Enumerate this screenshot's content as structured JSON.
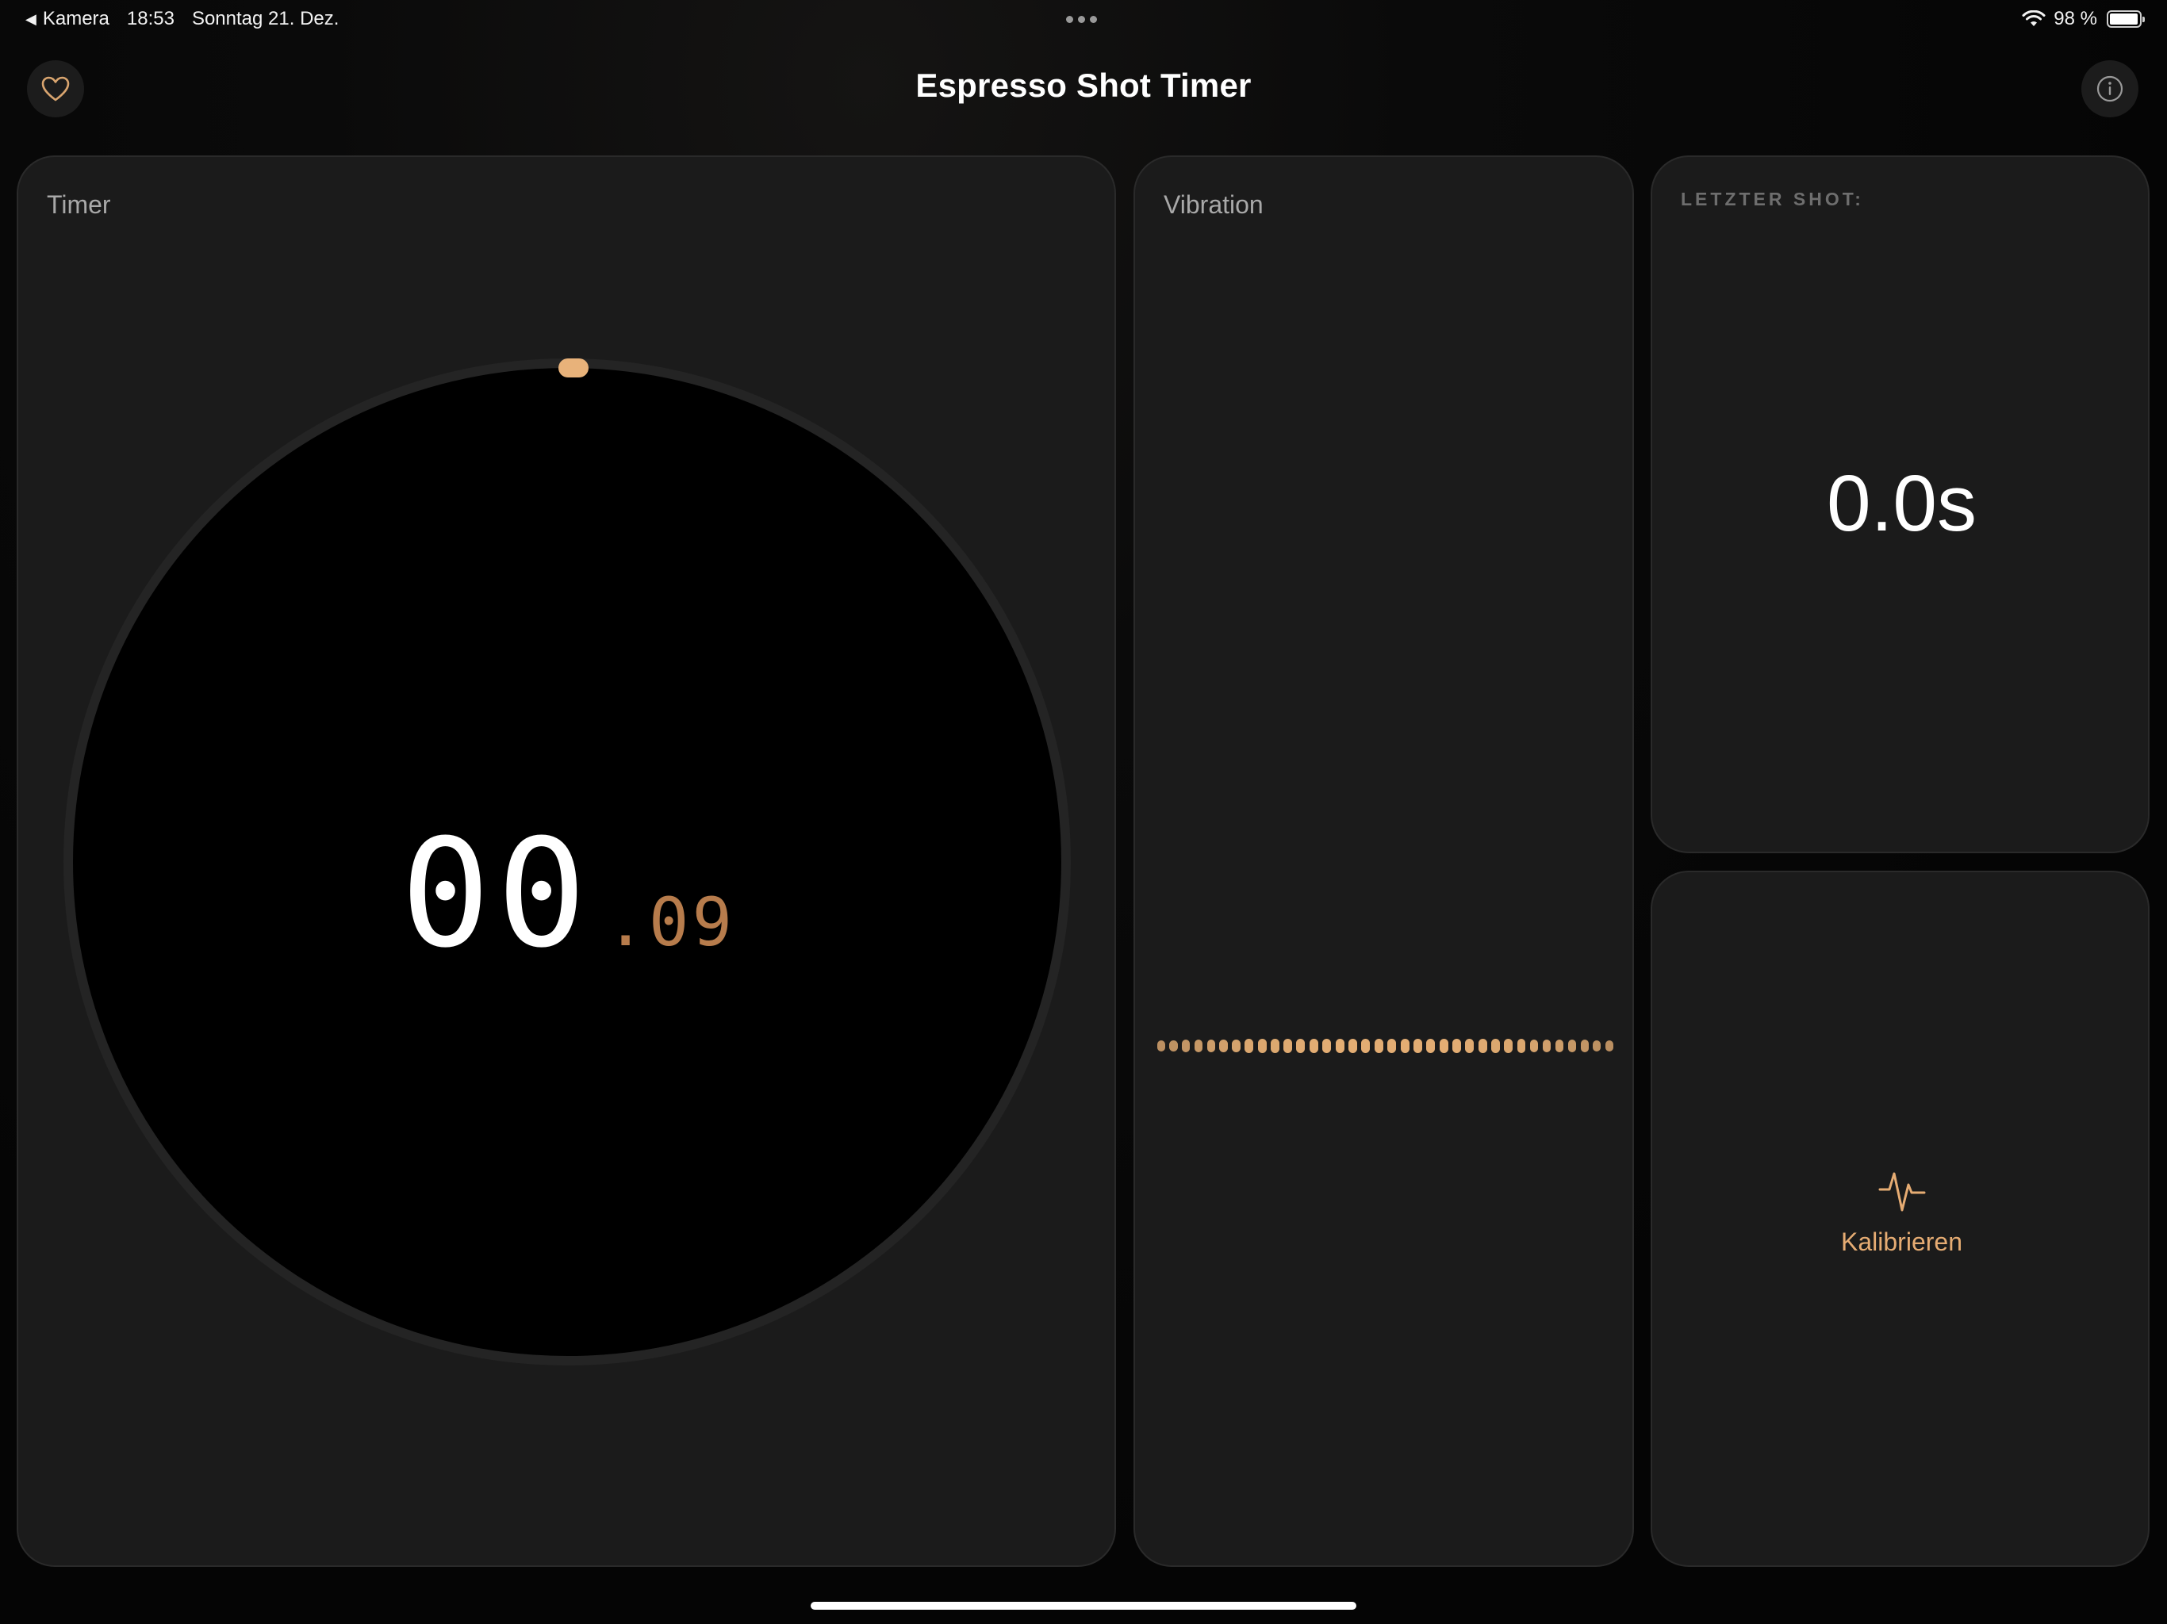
{
  "status_bar": {
    "back_app": "Kamera",
    "time": "18:53",
    "date": "Sonntag 21. Dez.",
    "battery_pct": "98 %",
    "battery_level": 0.98
  },
  "nav": {
    "title": "Espresso Shot Timer",
    "left_icon": "heart-icon",
    "right_icon": "info-icon"
  },
  "timer_card": {
    "label": "Timer",
    "seconds": "00",
    "fraction": ".09"
  },
  "vibration_card": {
    "label": "Vibration",
    "dot_levels": [
      0.55,
      0.6,
      0.65,
      0.7,
      0.75,
      0.8,
      0.85,
      0.9,
      0.92,
      0.94,
      0.96,
      0.98,
      1.0,
      1.0,
      1.0,
      1.0,
      1.0,
      1.0,
      1.0,
      1.0,
      1.0,
      1.0,
      1.0,
      1.0,
      0.98,
      0.96,
      0.94,
      0.92,
      0.9,
      0.85,
      0.8,
      0.75,
      0.7,
      0.65,
      0.6,
      0.55
    ]
  },
  "last_shot_card": {
    "label": "LETZTER SHOT:",
    "value": "0.0s"
  },
  "calibrate_card": {
    "icon": "waveform-icon",
    "label": "Kalibrieren"
  },
  "colors": {
    "accent": "#e6ac73",
    "accent_dim": "#b77c4c",
    "card_bg": "#1b1b1b",
    "background": "#060606"
  }
}
